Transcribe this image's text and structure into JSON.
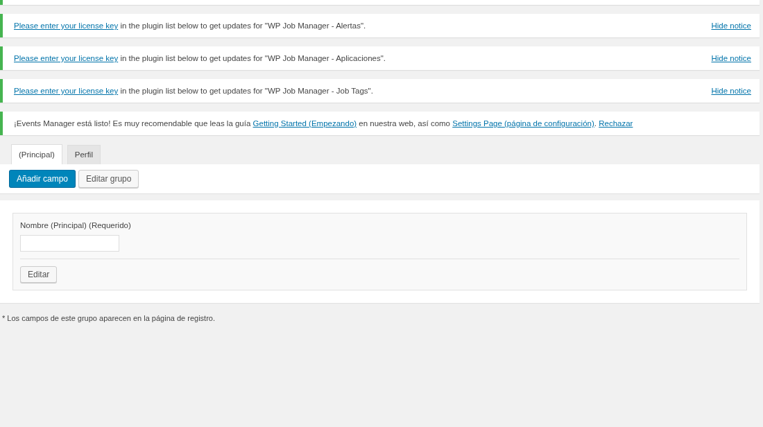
{
  "notices": [
    {
      "parts": [
        {
          "text": "Please enter your license key",
          "link": true
        },
        {
          "text": " in the plugin list below to get updates for \"WP Job Manager - Alertas\".",
          "link": false
        }
      ],
      "dismiss": "Hide notice"
    },
    {
      "parts": [
        {
          "text": "Please enter your license key",
          "link": true
        },
        {
          "text": " in the plugin list below to get updates for \"WP Job Manager - Aplicaciones\".",
          "link": false
        }
      ],
      "dismiss": "Hide notice"
    },
    {
      "parts": [
        {
          "text": "Please enter your license key",
          "link": true
        },
        {
          "text": " in the plugin list below to get updates for \"WP Job Manager - Job Tags\".",
          "link": false
        }
      ],
      "dismiss": "Hide notice"
    },
    {
      "parts": [
        {
          "text": "¡Events Manager está listo! Es muy recomendable que leas la guía ",
          "link": false
        },
        {
          "text": "Getting Started (Empezando)",
          "link": true
        },
        {
          "text": " en nuestra web, así como ",
          "link": false
        },
        {
          "text": "Settings Page (página de configuración)",
          "link": true
        },
        {
          "text": ". ",
          "link": false
        },
        {
          "text": "Rechazar",
          "link": true
        }
      ]
    }
  ],
  "tabs": [
    {
      "label": "(Principal)",
      "selected": true
    },
    {
      "label": "Perfil",
      "selected": false
    }
  ],
  "toolbar": [
    {
      "label": "Añadir campo",
      "kind": "primary"
    },
    {
      "label": "Editar grupo",
      "kind": "secondary"
    }
  ],
  "field": {
    "label": "Nombre (Principal) (Requerido)",
    "edit_button": "Editar"
  },
  "footnote": "* Los campos de este grupo aparecen en la página de registro."
}
